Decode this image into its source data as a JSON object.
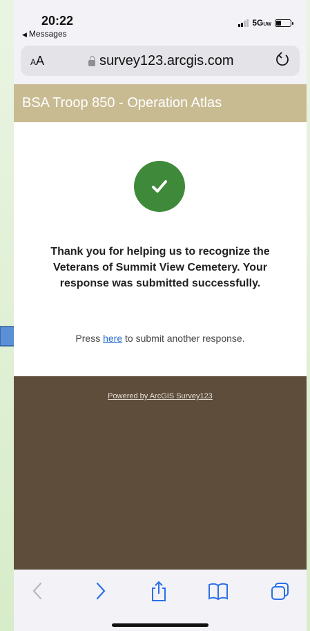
{
  "status_bar": {
    "time": "20:22",
    "back_app": "Messages",
    "network": "5G",
    "network_suffix": "UW"
  },
  "browser": {
    "aa_label_small": "A",
    "aa_label_large": "A",
    "url": "survey123.arcgis.com"
  },
  "page": {
    "header_title": "BSA Troop 850 - Operation Atlas",
    "confirmation_message": "Thank you for helping us to recognize the Veterans of Summit View Cemetery. Your response was submitted successfully.",
    "press_prefix": "Press ",
    "press_link": "here",
    "press_suffix": " to submit another response.",
    "footer_link": "Powered by ArcGIS Survey123"
  },
  "icons": {
    "back": "chevron-left-icon",
    "forward": "chevron-right-icon",
    "share": "share-icon",
    "bookmarks": "book-icon",
    "tabs": "tabs-icon",
    "check": "checkmark-icon",
    "lock": "lock-icon",
    "reload": "reload-icon"
  },
  "colors": {
    "header_bg": "#c8bb92",
    "check_bg": "#3f8a3a",
    "footer_bg": "#5e4d3b",
    "link": "#2b6fcf",
    "annotation_arrow": "#5b8fd6",
    "toolbar_active": "#2b6fe8"
  }
}
